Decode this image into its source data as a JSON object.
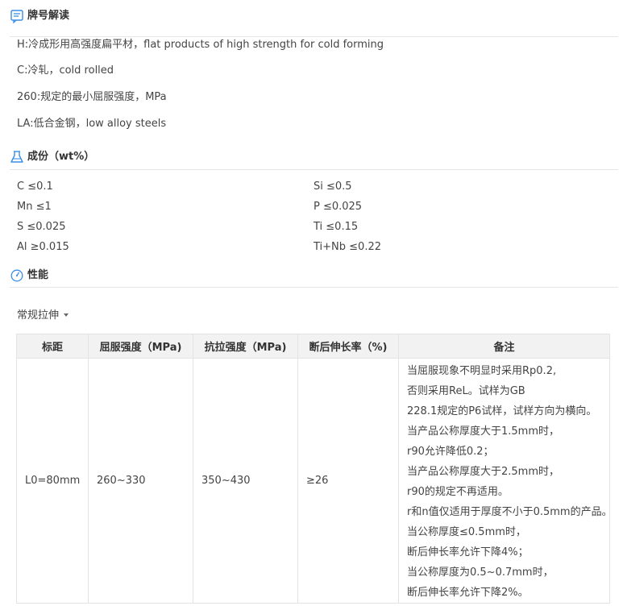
{
  "grade_section": {
    "title": "牌号解读",
    "icon": "document-icon",
    "lines": [
      "H:冷成形用高强度扁平材，flat products of high strength for cold forming",
      "C:冷轧，cold rolled",
      "260:规定的最小屈服强度，MPa",
      "LA:低合金钢，low alloy steels"
    ]
  },
  "composition_section": {
    "title": "成份（wt%）",
    "icon": "flask-icon",
    "left": [
      "C ≤0.1",
      "Mn ≤1",
      "S ≤0.025",
      "Al ≥0.015"
    ],
    "right": [
      "Si ≤0.5",
      "P ≤0.025",
      "Ti ≤0.15",
      "Ti+Nb ≤0.22"
    ]
  },
  "property_section": {
    "title": "性能",
    "icon": "gauge-icon",
    "dropdown_label": "常规拉伸",
    "table": {
      "headers": [
        "标距",
        "屈服强度（MPa)",
        "抗拉强度（MPa)",
        "断后伸长率（%)",
        "备注"
      ],
      "row": {
        "gauge": "L0=80mm",
        "yield": "260~330",
        "tensile": "350~430",
        "elongation": "≥26",
        "notes": [
          "当屈服现象不明显时采用Rp0.2,",
          "否则采用ReL。试样为GB",
          "228.1规定的P6试样，试样方向为横向。",
          "当产品公称厚度大于1.5mm时，",
          "r90允许降低0.2；",
          "当产品公称厚度大于2.5mm时，",
          "r90的规定不再适用。",
          "r和n值仅适用于厚度不小于0.5mm的产品。",
          "当公称厚度≤0.5mm时，",
          "断后伸长率允许下降4%；",
          "当公称厚度为0.5~0.7mm时，",
          "断后伸长率允许下降2%。"
        ]
      }
    }
  },
  "colors": {
    "accent": "#3a8ee6",
    "header_bg": "#f2f2f2",
    "border": "#e3e3e3",
    "divider": "#e6e6e6"
  }
}
